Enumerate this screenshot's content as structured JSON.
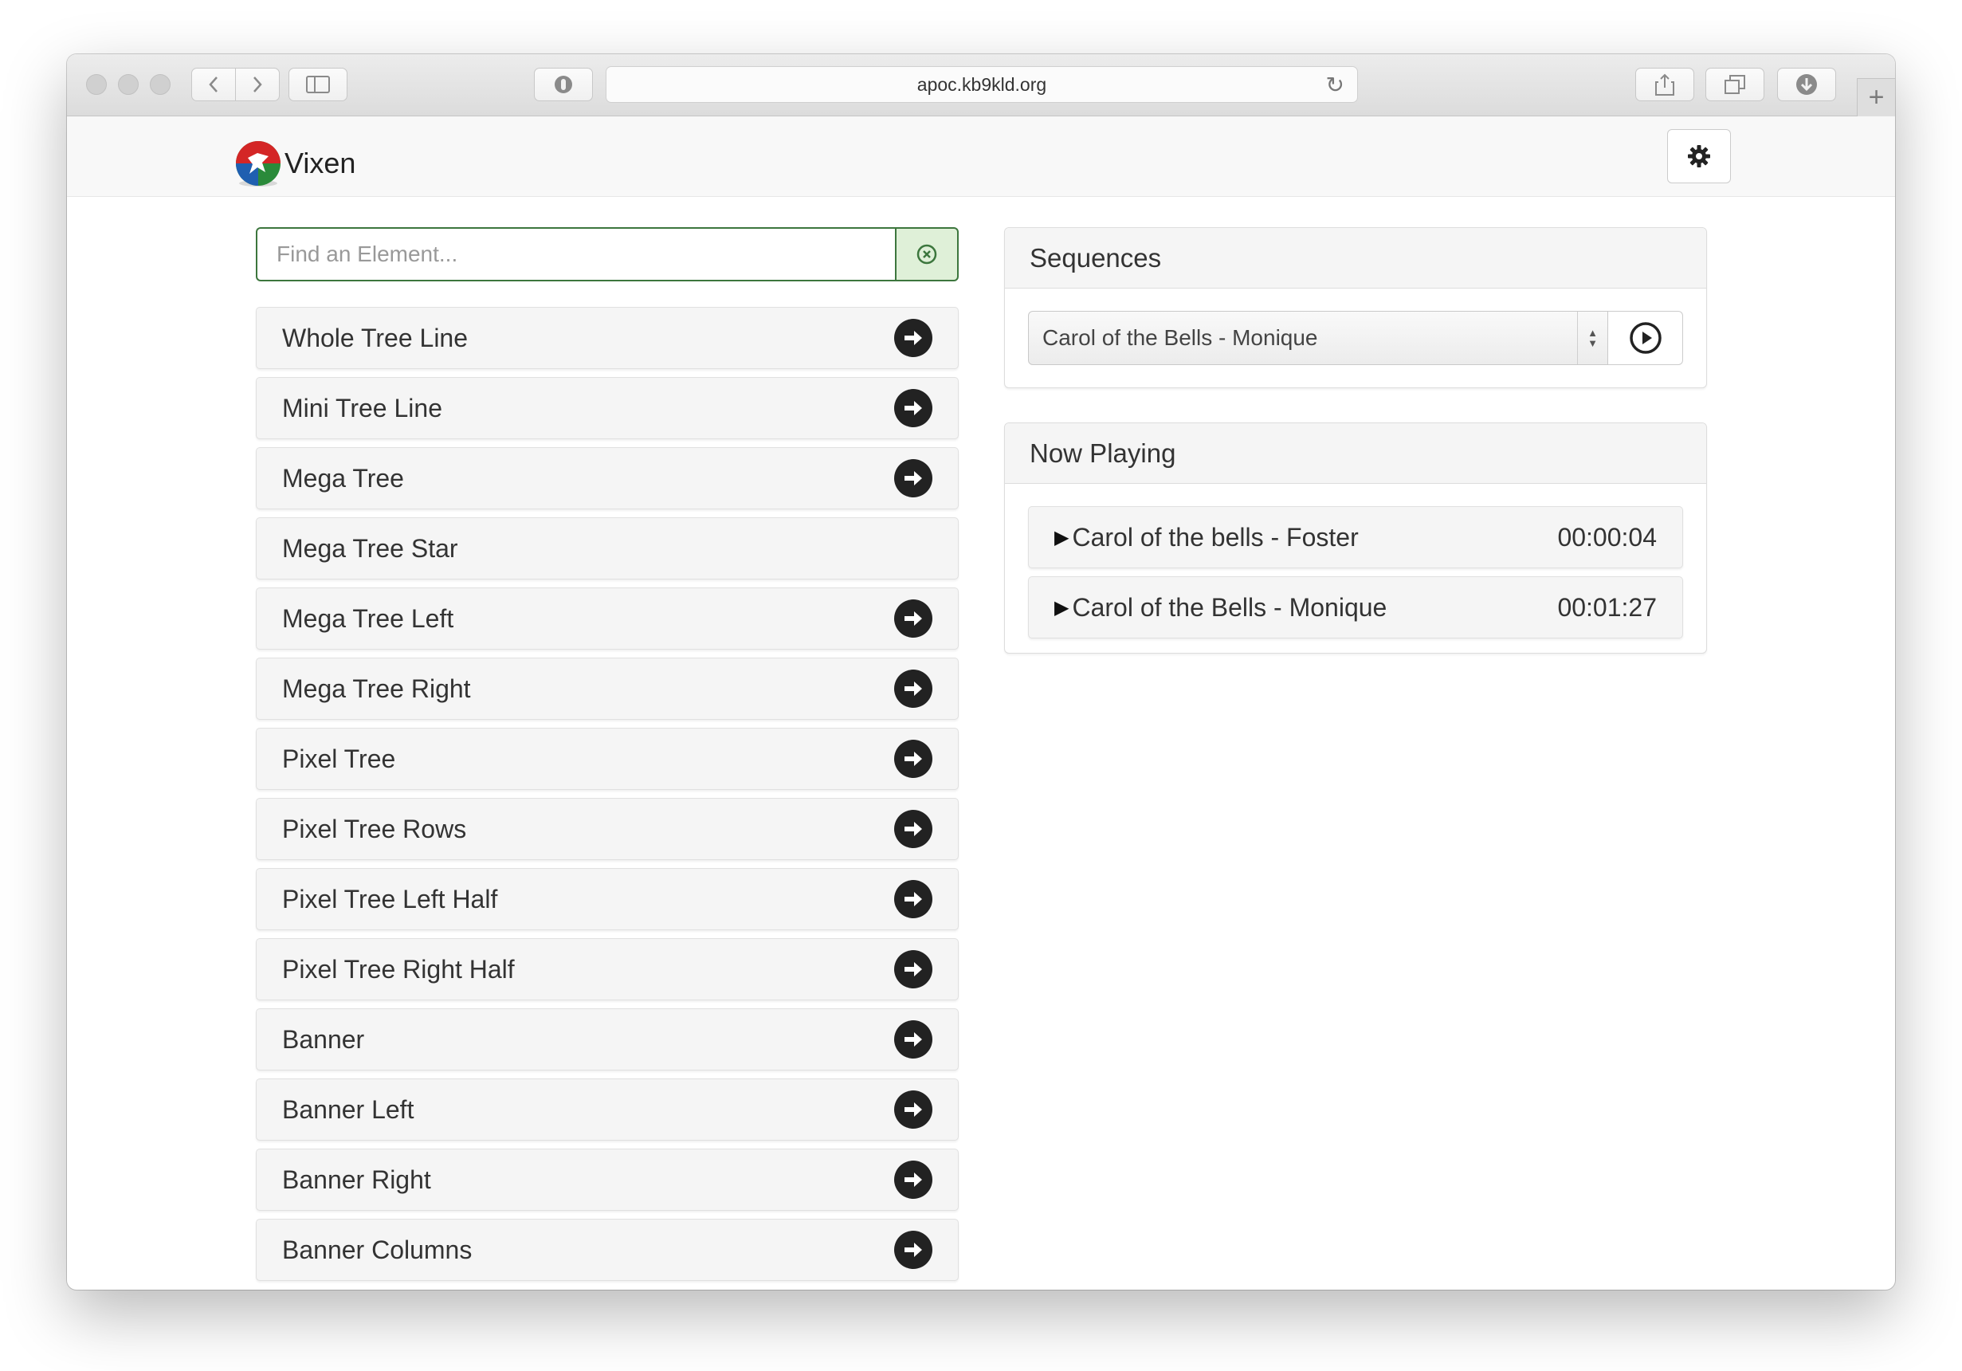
{
  "browser": {
    "url": "apoc.kb9kld.org"
  },
  "app": {
    "brand": "Vixen"
  },
  "search": {
    "placeholder": "Find an Element...",
    "value": ""
  },
  "elements": [
    {
      "label": "Whole Tree Line",
      "has_action": true
    },
    {
      "label": "Mini Tree Line",
      "has_action": true
    },
    {
      "label": "Mega Tree",
      "has_action": true
    },
    {
      "label": "Mega Tree Star",
      "has_action": false
    },
    {
      "label": "Mega Tree Left",
      "has_action": true
    },
    {
      "label": "Mega Tree Right",
      "has_action": true
    },
    {
      "label": "Pixel Tree",
      "has_action": true
    },
    {
      "label": "Pixel Tree Rows",
      "has_action": true
    },
    {
      "label": "Pixel Tree Left Half",
      "has_action": true
    },
    {
      "label": "Pixel Tree Right Half",
      "has_action": true
    },
    {
      "label": "Banner",
      "has_action": true
    },
    {
      "label": "Banner Left",
      "has_action": true
    },
    {
      "label": "Banner Right",
      "has_action": true
    },
    {
      "label": "Banner Columns",
      "has_action": true
    }
  ],
  "sequences": {
    "heading": "Sequences",
    "selected": "Carol of the Bells - Monique"
  },
  "now_playing": {
    "heading": "Now Playing",
    "items": [
      {
        "title": "Carol of the bells - Foster",
        "time": "00:00:04"
      },
      {
        "title": "Carol of the Bells - Monique",
        "time": "00:01:27"
      }
    ]
  },
  "colors": {
    "search_border": "#3c763d",
    "search_addon_bg": "#dff0d8",
    "arrow_button": "#222222"
  }
}
